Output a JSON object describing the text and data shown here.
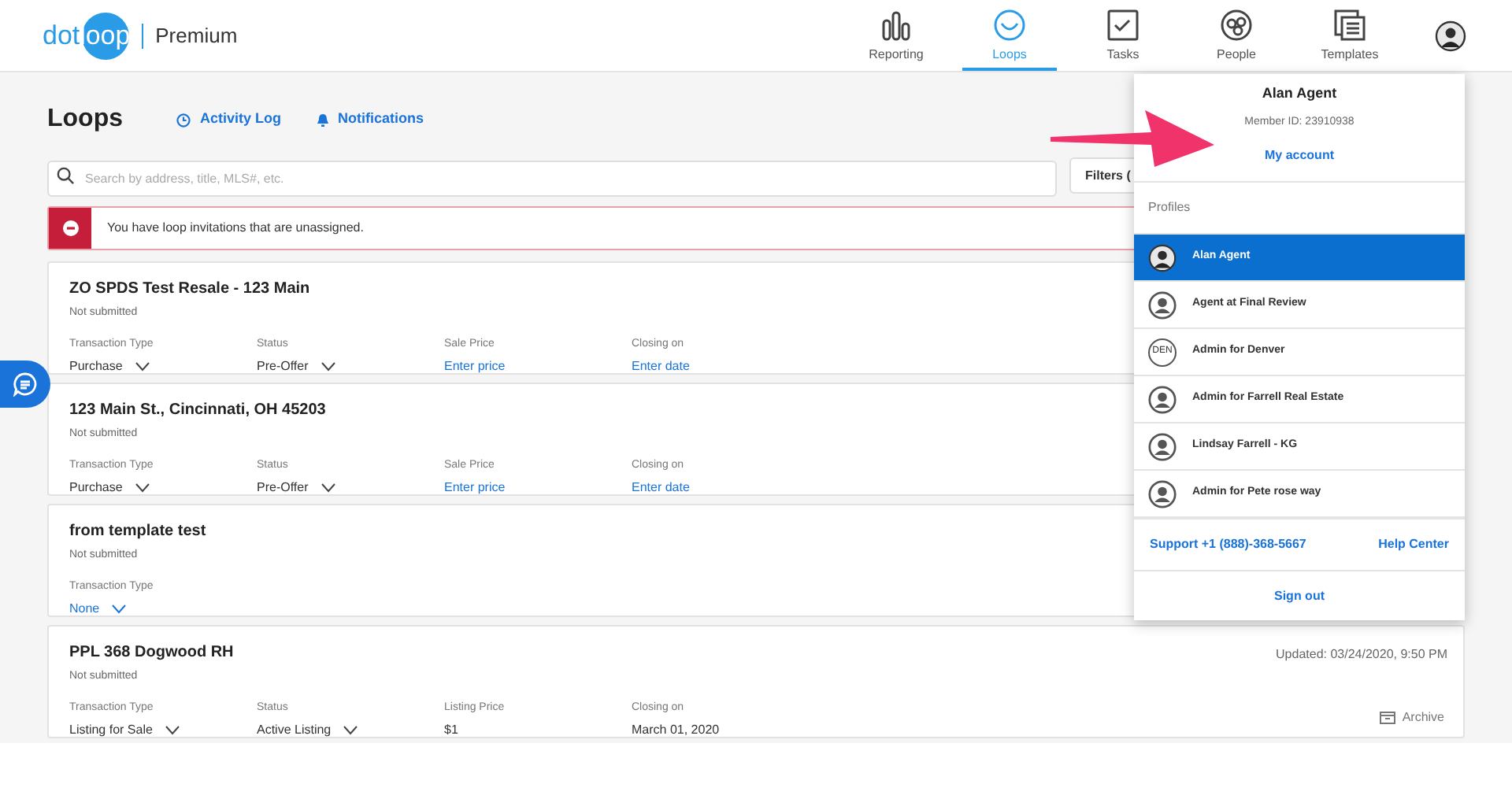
{
  "brand": {
    "logo_left": "dot",
    "logo_right": "loop",
    "plan": "Premium"
  },
  "nav": [
    {
      "label": "Reporting",
      "kind": "bars",
      "selected": false
    },
    {
      "label": "Loops",
      "kind": "loop",
      "selected": true
    },
    {
      "label": "Tasks",
      "kind": "check",
      "selected": false
    },
    {
      "label": "People",
      "kind": "people",
      "selected": false
    },
    {
      "label": "Templates",
      "kind": "pages",
      "selected": false
    }
  ],
  "page": {
    "title": "Loops",
    "links": [
      {
        "label": "Activity Log",
        "kind": "clock"
      },
      {
        "label": "Notifications",
        "kind": "bell"
      }
    ]
  },
  "search": {
    "placeholder": "Search by address, title, MLS#, etc."
  },
  "filters_button": "Filters (",
  "alert": {
    "message": "You have loop invitations that are unassigned."
  },
  "loops": [
    {
      "title": "ZO SPDS Test Resale - 123 Main",
      "status": "Not submitted",
      "fields": [
        {
          "label": "Transaction Type",
          "value": "Purchase",
          "kind": "select"
        },
        {
          "label": "Status",
          "value": "Pre-Offer",
          "kind": "select"
        },
        {
          "label": "Sale Price",
          "value": "Enter price",
          "kind": "link"
        },
        {
          "label": "Closing on",
          "value": "Enter date",
          "kind": "link"
        }
      ]
    },
    {
      "title": "123 Main St., Cincinnati, OH 45203",
      "status": "Not submitted",
      "fields": [
        {
          "label": "Transaction Type",
          "value": "Purchase",
          "kind": "select"
        },
        {
          "label": "Status",
          "value": "Pre-Offer",
          "kind": "select"
        },
        {
          "label": "Sale Price",
          "value": "Enter price",
          "kind": "link"
        },
        {
          "label": "Closing on",
          "value": "Enter date",
          "kind": "link"
        }
      ]
    },
    {
      "title": "from template test",
      "status": "Not submitted",
      "fields": [
        {
          "label": "Transaction Type",
          "value": "None",
          "kind": "link-select"
        }
      ]
    },
    {
      "title": "PPL 368 Dogwood RH",
      "status": "Not submitted",
      "updated": "Updated: 03/24/2020, 9:50 PM",
      "archive": "Archive",
      "fields": [
        {
          "label": "Transaction Type",
          "value": "Listing for Sale",
          "kind": "select"
        },
        {
          "label": "Status",
          "value": "Active Listing",
          "kind": "select"
        },
        {
          "label": "Listing Price",
          "value": "$1",
          "kind": "plain"
        },
        {
          "label": "Closing on",
          "value": "March 01, 2020",
          "kind": "plain"
        }
      ]
    }
  ],
  "account_menu": {
    "name": "Alan Agent",
    "member_id": "Member ID: 23910938",
    "account_link": "My account",
    "profiles_label": "Profiles",
    "profiles": [
      {
        "name": "Alan Agent",
        "kind": "photo",
        "selected": true
      },
      {
        "name": "Agent at Final Review",
        "kind": "person",
        "selected": false
      },
      {
        "name": "Admin for Denver",
        "kind": "initials",
        "initials": "DEN",
        "selected": false
      },
      {
        "name": "Admin for Farrell Real Estate",
        "kind": "person",
        "selected": false
      },
      {
        "name": "Lindsay Farrell - KG",
        "kind": "person",
        "selected": false
      },
      {
        "name": "Admin for Pete rose way",
        "kind": "person",
        "selected": false
      }
    ],
    "support": "Support +1 (888)-368-5667",
    "help": "Help Center",
    "sign_out": "Sign out"
  }
}
